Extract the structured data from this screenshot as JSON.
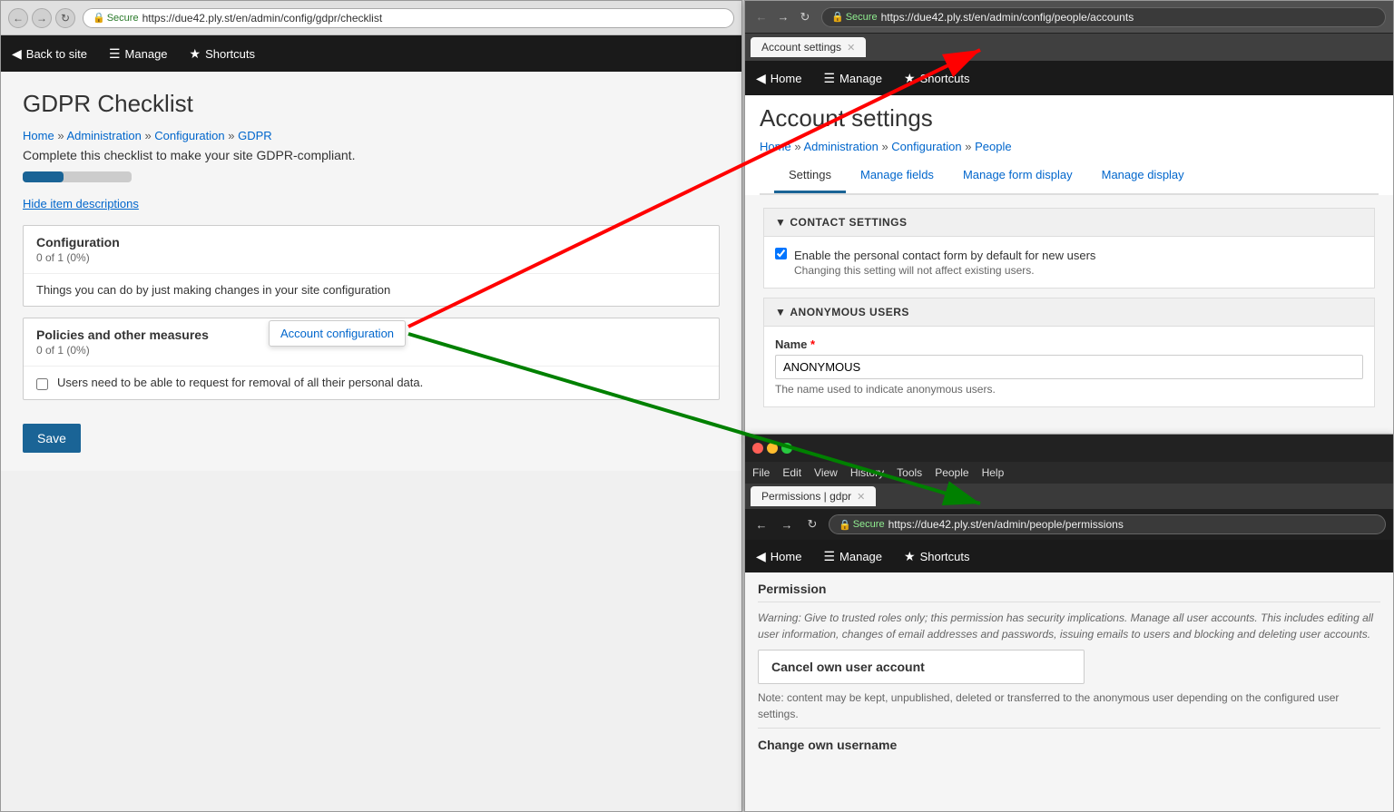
{
  "main_window": {
    "address": "https://due42.ply.st/en/admin/config/gdpr/checklist",
    "secure_label": "Secure",
    "title": "GDPR Checklist",
    "toolbar": {
      "back_label": "Back to site",
      "manage_label": "Manage",
      "shortcuts_label": "Shortcuts"
    },
    "breadcrumb": [
      "Home",
      "Administration",
      "Configuration",
      "GDPR"
    ],
    "description": "Complete this checklist to make your site GDPR-compliant.",
    "hide_label": "Hide item descriptions",
    "sections": [
      {
        "title": "Configuration",
        "subtitle": "0 of 1 (0%)",
        "item_text": "Things you can do by just making changes in your site configuration"
      },
      {
        "title": "Policies and other measures",
        "subtitle": "0 of 1 (0%)",
        "item_text": "Users need to be able to request for removal of all their personal data."
      }
    ],
    "tooltip": "Account configuration",
    "save_label": "Save"
  },
  "second_window": {
    "tab_label": "Account settings",
    "address": "https://due42.ply.st/en/admin/config/people/accounts",
    "secure_label": "Secure",
    "title": "Account settings",
    "toolbar": {
      "home_label": "Home",
      "manage_label": "Manage",
      "shortcuts_label": "Shortcuts"
    },
    "breadcrumb": [
      "Home",
      "Administration",
      "Configuration",
      "People"
    ],
    "tabs": [
      "Settings",
      "Manage fields",
      "Manage form display",
      "Manage display"
    ],
    "active_tab": "Settings",
    "contact_settings": {
      "header": "CONTACT SETTINGS",
      "checkbox_label": "Enable the personal contact form by default for new users",
      "checkbox_sub": "Changing this setting will not affect existing users."
    },
    "anonymous_users": {
      "header": "ANONYMOUS USERS",
      "name_label": "Name",
      "name_value": "ANONYMOUS",
      "name_help": "The name used to indicate anonymous users."
    }
  },
  "third_window": {
    "tab_label": "Permissions | gdpr",
    "address": "https://due42.ply.st/en/admin/people/permissions",
    "secure_label": "Secure",
    "menu_items": [
      "File",
      "Edit",
      "View",
      "History",
      "Tools",
      "People",
      "Help"
    ],
    "toolbar": {
      "home_label": "Home",
      "manage_label": "Manage",
      "shortcuts_label": "Shortcuts"
    },
    "permission_header": "Permission",
    "warning_text": "Warning: Give to trusted roles only; this permission has security implications. Manage all user accounts. This includes editing all user information, changes of email addresses and passwords, issuing emails to users and blocking and deleting user accounts.",
    "cancel_account_label": "Cancel own user account",
    "note_text": "Note: content may be kept, unpublished, deleted or transferred to the anonymous user depending on the configured user settings.",
    "change_username_label": "Change own username"
  }
}
